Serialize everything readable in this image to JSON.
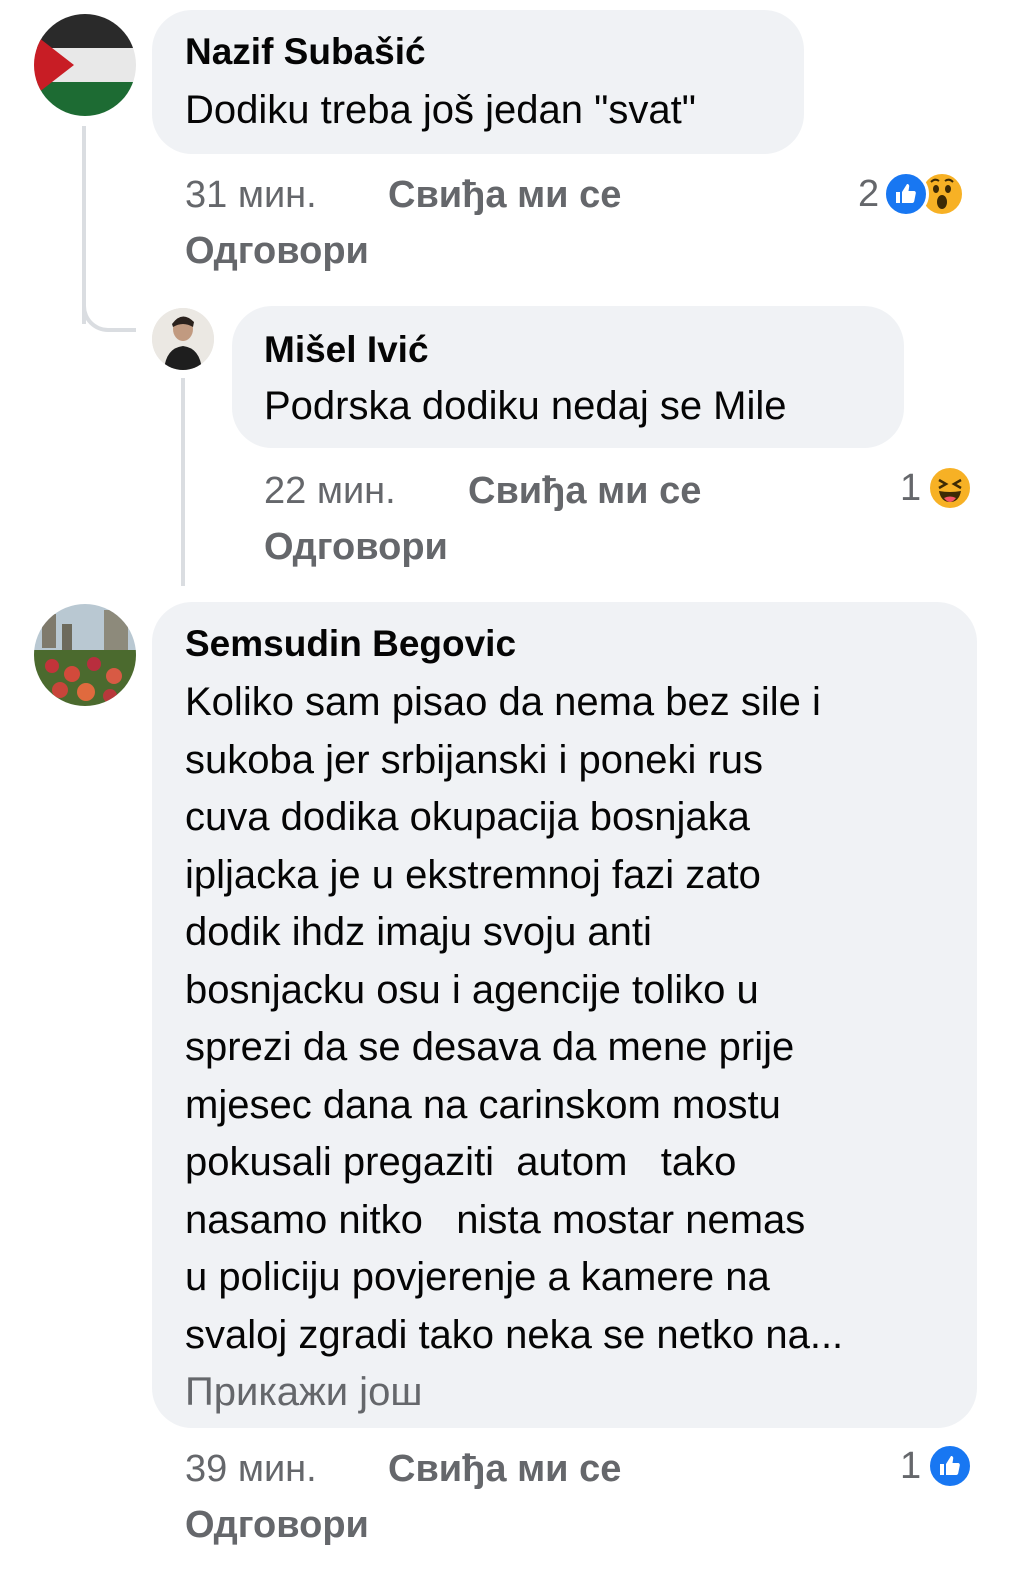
{
  "comments": [
    {
      "author": "Nazif Subašić",
      "text": "Dodiku treba još jedan \"svat\"",
      "time": "31 мин.",
      "like_label": "Свиђа ми се",
      "reply_label": "Одговори",
      "reaction_count": "2",
      "reactions": [
        "like-icon",
        "wow-icon"
      ]
    },
    {
      "author": "Mišel Ivić",
      "text": "Podrska dodiku nedaj se Mile",
      "time": "22 мин.",
      "like_label": "Свиђа ми се",
      "reply_label": "Одговори",
      "reaction_count": "1",
      "reactions": [
        "haha-icon"
      ]
    },
    {
      "author": "Semsudin Begovic",
      "text_lines": [
        "Koliko sam pisao da nema bez sile i",
        "sukoba jer srbijanski i poneki rus",
        "cuva dodika okupacija bosnjaka",
        "ipljacka je u ekstremnoj fazi zato",
        "dodik ihdz imaju svoju anti",
        "bosnjacku osu i agencije toliko u",
        "sprezi da se desava da mene prije",
        "mjesec dana na carinskom mostu",
        "pokusali pregaziti  autom   tako",
        "nasamo nitko   nista mostar nemas",
        "u policiju povjerenje a kamere na",
        "svaloj zgradi tako neka se netko na..."
      ],
      "see_more": "Прикажи још",
      "time": "39 мин.",
      "like_label": "Свиђа ми се",
      "reply_label": "Одговори",
      "reaction_count": "1",
      "reactions": [
        "like-icon"
      ]
    }
  ],
  "colors": {
    "bubble": "#f0f2f5",
    "meta": "#65676b",
    "like": "#1877f2",
    "emoji": "#f7b125"
  }
}
